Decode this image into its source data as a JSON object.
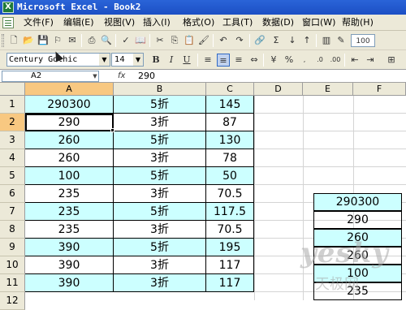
{
  "window": {
    "title": "Microsoft Excel - Book2",
    "app_icon": "X"
  },
  "menu": [
    "文件(F)",
    "编辑(E)",
    "视图(V)",
    "插入(I)",
    "格式(O)",
    "工具(T)",
    "数据(D)",
    "窗口(W)",
    "帮助(H)"
  ],
  "toolbar": {
    "zoom": "100",
    "font_name": "Century Gothic",
    "font_size": "14",
    "bold": "B",
    "italic": "I",
    "underline": "U"
  },
  "formula_bar": {
    "name_box": "A2",
    "fx": "fx",
    "value": "290"
  },
  "columns": [
    "A",
    "B",
    "C",
    "D",
    "E",
    "F"
  ],
  "rows": [
    "1",
    "2",
    "3",
    "4",
    "5",
    "6",
    "7",
    "8",
    "9",
    "10",
    "11",
    "12"
  ],
  "selected": {
    "column": "A",
    "row": "2"
  },
  "cells": [
    {
      "a": "290300",
      "b": "5折",
      "c": "145",
      "cyan": true
    },
    {
      "a": "290",
      "b": "3折",
      "c": "87",
      "cyan": false
    },
    {
      "a": "260",
      "b": "5折",
      "c": "130",
      "cyan": true
    },
    {
      "a": "260",
      "b": "3折",
      "c": "78",
      "cyan": false
    },
    {
      "a": "100",
      "b": "5折",
      "c": "50",
      "cyan": true
    },
    {
      "a": "235",
      "b": "3折",
      "c": "70.5",
      "cyan": false
    },
    {
      "a": "235",
      "b": "5折",
      "c": "117.5",
      "cyan": true
    },
    {
      "a": "235",
      "b": "3折",
      "c": "70.5",
      "cyan": false
    },
    {
      "a": "390",
      "b": "5折",
      "c": "195",
      "cyan": true
    },
    {
      "a": "390",
      "b": "3折",
      "c": "117",
      "cyan": false
    },
    {
      "a": "390",
      "b": "3折",
      "c": "117",
      "cyan": true
    }
  ],
  "side_table": [
    {
      "value": "290300",
      "cyan": true
    },
    {
      "value": "290",
      "cyan": false
    },
    {
      "value": "260",
      "cyan": true
    },
    {
      "value": "260",
      "cyan": false
    },
    {
      "value": "100",
      "cyan": true
    },
    {
      "value": "235",
      "cyan": false
    }
  ],
  "watermark": {
    "text": "yesky",
    "sub": "天极网"
  },
  "colors": {
    "title_bar": "#2a64d8",
    "chrome": "#ece9d8",
    "selected_header": "#f8c881",
    "cyan_fill": "#ccffff"
  }
}
